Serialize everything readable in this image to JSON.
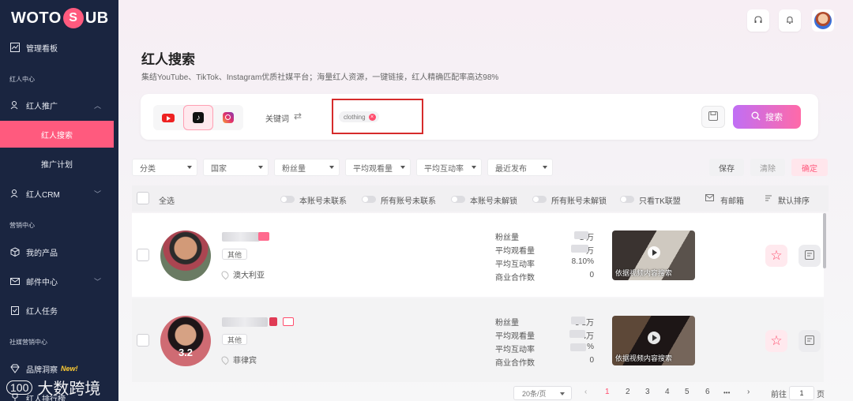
{
  "app": {
    "logo_text_left": "WOTO",
    "logo_badge": "S",
    "logo_text_right": "UB"
  },
  "sidebar": {
    "dashboard": "管理看板",
    "section_influencer": "红人中心",
    "influencer_promo": "红人推广",
    "influencer_search": "红人搜索",
    "promo_plan": "推广计划",
    "influencer_crm": "红人CRM",
    "section_marketing": "营销中心",
    "my_products": "我的产品",
    "mail_center": "邮件中心",
    "influencer_tasks": "红人任务",
    "section_social": "社媒营销中心",
    "brand_insight": "品牌洞察",
    "new_badge": "New!",
    "leaderboard": "红人排行榜"
  },
  "watermark": {
    "logo": "100",
    "text": "大数跨境"
  },
  "page": {
    "title": "红人搜索",
    "description": "集结YouTube、TikTok、Instagram优质社媒平台；海量红人资源，一键链接，红人精确匹配率高达98%"
  },
  "search": {
    "keyword_label": "关键词",
    "swap_icon": "⇄",
    "tag": "clothing",
    "search_button": "搜索"
  },
  "filters": {
    "category": "分类",
    "country": "国家",
    "followers": "粉丝量",
    "avg_views": "平均观看量",
    "avg_engagement": "平均互动率",
    "recent_post": "最近发布",
    "save": "保存",
    "clear": "清除",
    "confirm": "确定"
  },
  "table_head": {
    "select_all": "全选",
    "t1": "本账号未联系",
    "t2": "所有账号未联系",
    "t3": "本账号未解锁",
    "t4": "所有账号未解锁",
    "t5": "只看TK联盟",
    "has_email": "有邮箱",
    "default_sort": "默认排序"
  },
  "rows": [
    {
      "category": "其他",
      "location": "澳大利亚",
      "score": "",
      "labels": [
        "粉丝量",
        "平均观看量",
        "平均互动率",
        "商业合作数"
      ],
      "values": [
        "1    万",
        "    万",
        "8.10%",
        "0"
      ],
      "thumb_caption": "依据视频内容搜索"
    },
    {
      "category": "其他",
      "location": "菲律宾",
      "score": "3.2",
      "labels": [
        "粉丝量",
        "平均观看量",
        "平均互动率",
        "商业合作数"
      ],
      "values": [
        "5    1万",
        "    4万",
        "    %",
        "0"
      ],
      "thumb_caption": "依据视频内容搜索"
    }
  ],
  "pagination": {
    "page_size": "20条/页",
    "prev": "‹",
    "pages": [
      "1",
      "2",
      "3",
      "4",
      "5",
      "6"
    ],
    "ellipsis": "•••",
    "next": "›",
    "goto_label": "前往",
    "goto_value": "1",
    "page_unit": "页"
  },
  "colors": {
    "accent": "#ff5a7e",
    "sidebar_bg": "#1a2540"
  }
}
